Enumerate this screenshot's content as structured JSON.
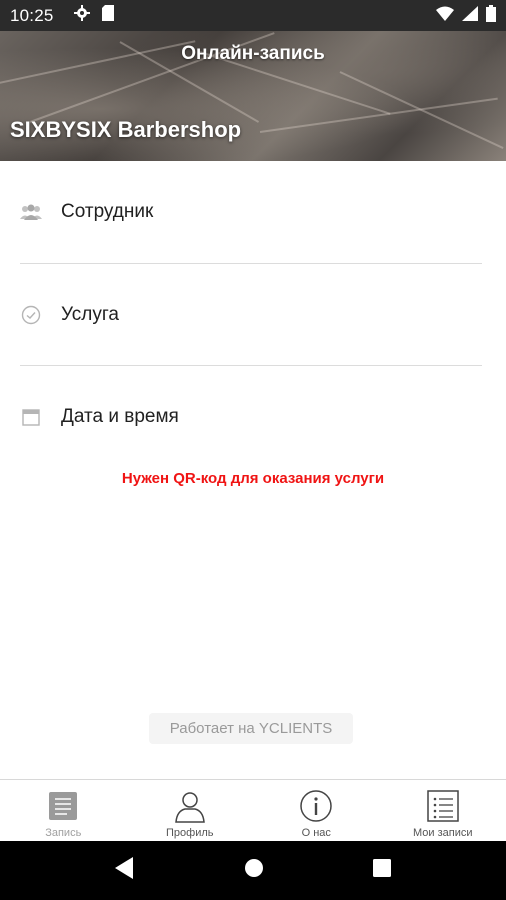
{
  "status_bar": {
    "time": "10:25",
    "icons": [
      "gear-icon",
      "sim-card-icon",
      "wifi-icon",
      "signal-icon",
      "battery-icon"
    ]
  },
  "header": {
    "title": "Онлайн-запись",
    "shop_name": "SIXBYSIX Barbershop"
  },
  "menu": {
    "items": [
      {
        "label": "Сотрудник",
        "icon": "people-icon"
      },
      {
        "label": "Услуга",
        "icon": "check-circle-icon"
      },
      {
        "label": "Дата и время",
        "icon": "calendar-icon"
      }
    ]
  },
  "warning_text": "Нужен QR-код для оказания услуги",
  "powered_by": "Работает на YCLIENTS",
  "bottom_nav": {
    "items": [
      {
        "label": "Запись",
        "icon": "book-icon",
        "active": true
      },
      {
        "label": "Профиль",
        "icon": "profile-icon",
        "active": false
      },
      {
        "label": "О нас",
        "icon": "info-icon",
        "active": false
      },
      {
        "label": "Мои записи",
        "icon": "list-icon",
        "active": false
      }
    ]
  },
  "colors": {
    "warning": "#f01414",
    "status_bar_bg": "#2b2b2b",
    "nav_active": "#a0a0a0"
  }
}
